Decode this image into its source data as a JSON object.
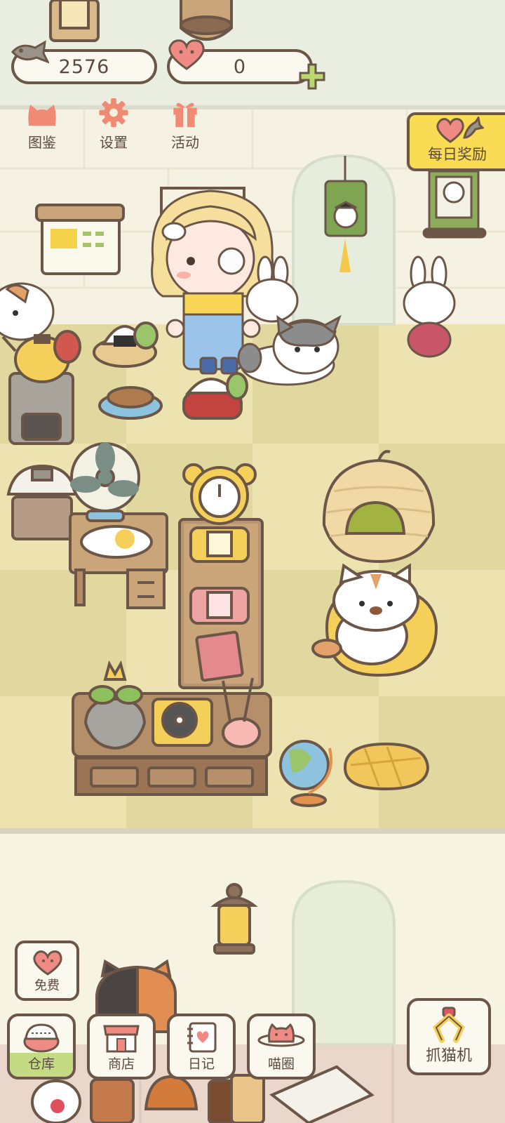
{
  "currency": {
    "fish": "2576",
    "hearts": "0"
  },
  "menu": {
    "catalog": "图鉴",
    "settings": "设置",
    "events": "活动"
  },
  "daily_reward": "每日奖励",
  "free_button": "免费",
  "bottom_nav": {
    "warehouse": "仓库",
    "shop": "商店",
    "diary": "日记",
    "meow_circle": "喵圈",
    "claw_machine": "抓猫机"
  },
  "colors": {
    "outline": "#6b5648",
    "floor_light": "#ece3b0",
    "floor_dark": "#e0d89e",
    "wall": "#f3efdf",
    "accent_yellow": "#f9dc54",
    "accent_green": "#c3dc84",
    "accent_pink": "#f08a84"
  }
}
